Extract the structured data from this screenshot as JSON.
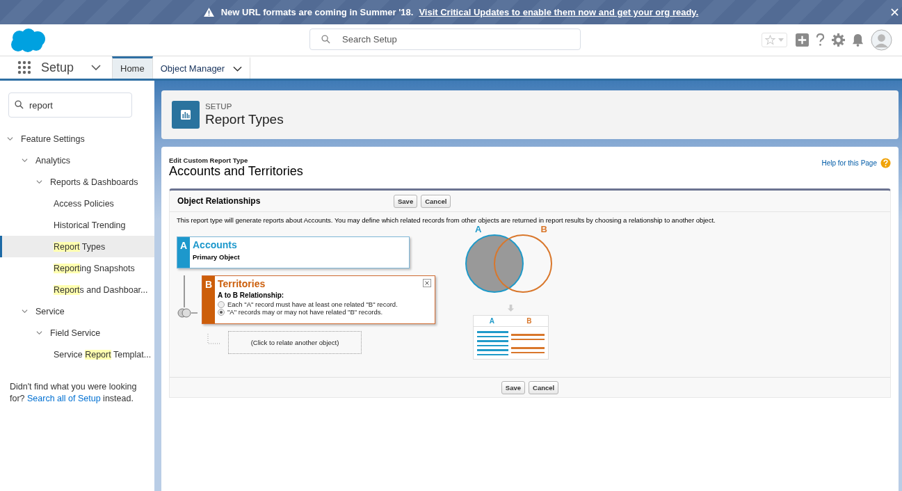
{
  "banner": {
    "message": "New URL formats are coming in Summer '18.",
    "link": "Visit Critical Updates to enable them now and get your org ready."
  },
  "header": {
    "search": {
      "placeholder": "Search Setup"
    }
  },
  "nav": {
    "app_name": "Setup",
    "tabs": [
      {
        "label": "Home",
        "selected": true,
        "menu": false
      },
      {
        "label": "Object Manager",
        "selected": false,
        "menu": true
      }
    ]
  },
  "sidebar": {
    "search": {
      "value": "report"
    },
    "tree": [
      {
        "parts": [
          {
            "text": "Feature Settings",
            "highlight": false
          }
        ],
        "expanded": true,
        "selected": false,
        "children": [
          {
            "parts": [
              {
                "text": "Analytics",
                "highlight": false
              }
            ],
            "expanded": true,
            "selected": false,
            "children": [
              {
                "parts": [
                  {
                    "text": "Reports & Dashboards",
                    "highlight": false
                  }
                ],
                "expanded": true,
                "selected": false,
                "children": [
                  {
                    "parts": [
                      {
                        "text": "Access Policies",
                        "highlight": false
                      }
                    ],
                    "selected": false
                  },
                  {
                    "parts": [
                      {
                        "text": "Historical Trending",
                        "highlight": false
                      }
                    ],
                    "selected": false
                  },
                  {
                    "parts": [
                      {
                        "text": "Report",
                        "highlight": true
                      },
                      {
                        "text": " Types",
                        "highlight": false
                      }
                    ],
                    "selected": true
                  },
                  {
                    "parts": [
                      {
                        "text": "Report",
                        "highlight": true
                      },
                      {
                        "text": "ing Snapshots",
                        "highlight": false
                      }
                    ],
                    "selected": false
                  },
                  {
                    "parts": [
                      {
                        "text": "Report",
                        "highlight": true
                      },
                      {
                        "text": "s and Dashboar...",
                        "highlight": false
                      }
                    ],
                    "selected": false
                  }
                ]
              }
            ]
          },
          {
            "parts": [
              {
                "text": "Service",
                "highlight": false
              }
            ],
            "expanded": true,
            "selected": false,
            "children": [
              {
                "parts": [
                  {
                    "text": "Field Service",
                    "highlight": false
                  }
                ],
                "expanded": true,
                "selected": false,
                "children": [
                  {
                    "parts": [
                      {
                        "text": "Service ",
                        "highlight": false
                      },
                      {
                        "text": "Report",
                        "highlight": true
                      },
                      {
                        "text": " Templat...",
                        "highlight": false
                      }
                    ],
                    "selected": false
                  }
                ]
              }
            ]
          }
        ]
      }
    ],
    "footer": {
      "before": "Didn't find what you were looking for?",
      "link": "Search all of Setup",
      "after": "instead."
    }
  },
  "page_header": {
    "eyebrow": "SETUP",
    "title": "Report Types"
  },
  "content": {
    "subtitle": "Edit Custom Report Type",
    "title": "Accounts and Territories",
    "help": "Help for this Page",
    "section": {
      "title": "Object Relationships",
      "buttons": [
        "Save",
        "Cancel"
      ],
      "description": "This report type will generate reports about Accounts. You may define which related records from other objects are returned in report results by choosing a relationship to another object.",
      "objects": [
        {
          "kind": "primary",
          "letter": "A",
          "name": "Accounts",
          "caption": "Primary Object"
        },
        {
          "kind": "related",
          "letter": "B",
          "name": "Territories",
          "relationship_label": "A to B Relationship:",
          "options": [
            {
              "label": "Each \"A\" record must have at least one related \"B\" record.",
              "selected": false
            },
            {
              "label": "\"A\" records may or may not have related \"B\" records.",
              "selected": true
            }
          ]
        }
      ],
      "add_object": "(Click to relate another object)",
      "venn_labels": [
        "A",
        "B"
      ],
      "result_columns": [
        "A",
        "B"
      ],
      "footer_buttons": [
        "Save",
        "Cancel"
      ]
    }
  }
}
